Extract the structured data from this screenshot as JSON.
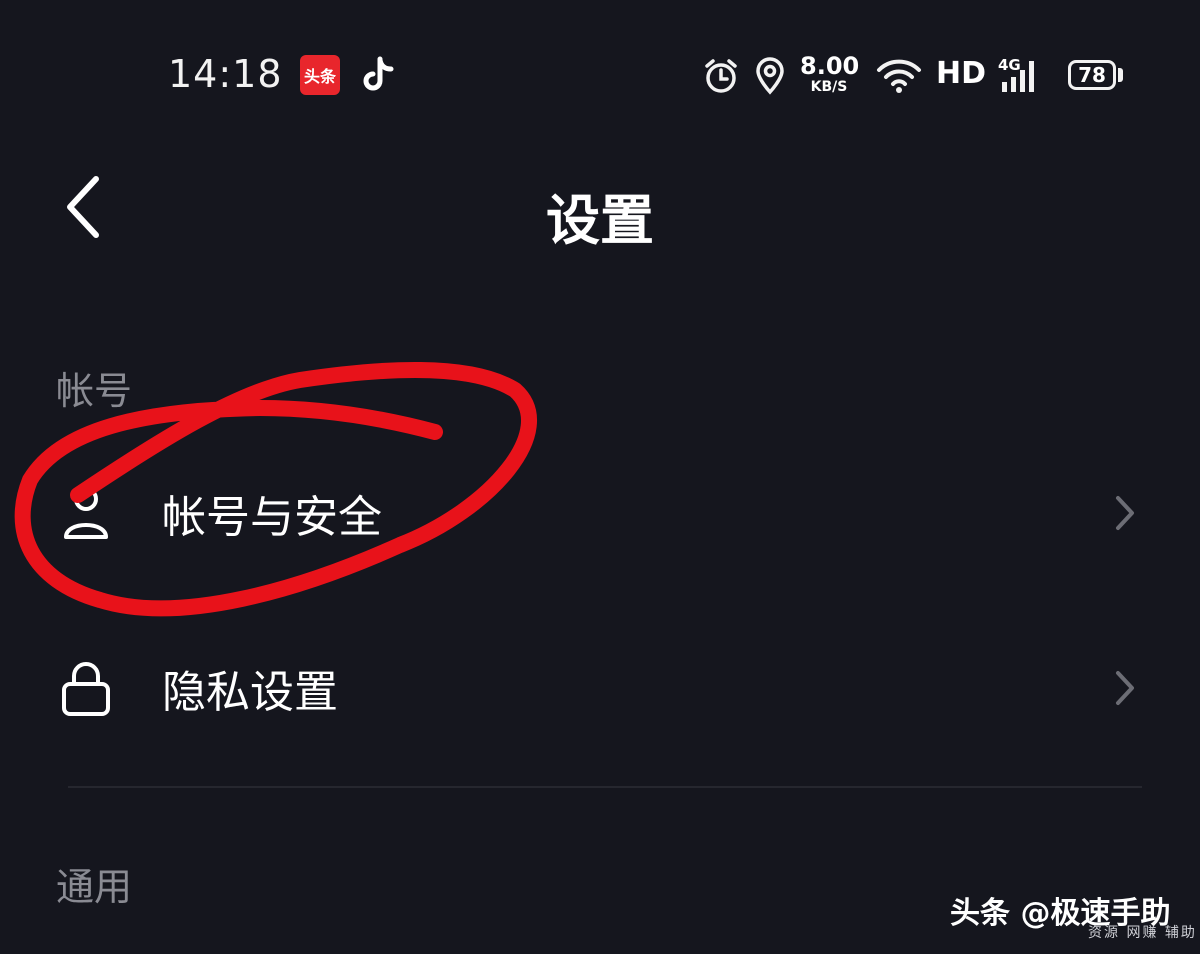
{
  "status_bar": {
    "time": "14:18",
    "toutiao_icon_text": "头条",
    "net_speed_value": "8.00",
    "net_speed_unit": "KB/S",
    "hd_label": "HD",
    "network_label": "4G",
    "battery_level": "78"
  },
  "header": {
    "title": "设置"
  },
  "sections": [
    {
      "header": "帐号",
      "items": [
        {
          "label": "帐号与安全",
          "icon": "user-icon"
        },
        {
          "label": "隐私设置",
          "icon": "lock-icon"
        }
      ]
    },
    {
      "header": "通用",
      "items": []
    }
  ],
  "watermark": {
    "line1": "头条 @极速手助",
    "line2": "资源 网赚 辅助"
  },
  "colors": {
    "background": "#15161e",
    "section_header": "#8a8b93",
    "annotation_red": "#e8121a"
  }
}
